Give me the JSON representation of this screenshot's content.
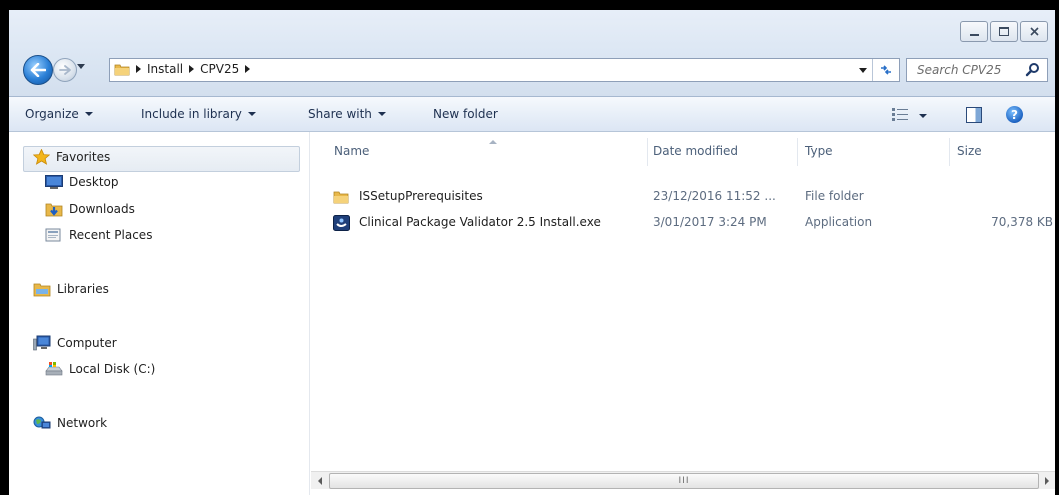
{
  "window": {
    "caption_buttons": [
      "minimize",
      "maximize",
      "close"
    ]
  },
  "address": {
    "crumbs": [
      "Install",
      "CPV25"
    ],
    "refresh_icon": "refresh-icon"
  },
  "search": {
    "placeholder": "Search CPV25"
  },
  "toolbar": {
    "organize": "Organize",
    "include_in_library": "Include in library",
    "share_with": "Share with",
    "new_folder": "New folder"
  },
  "nav": {
    "favorites": "Favorites",
    "desktop": "Desktop",
    "downloads": "Downloads",
    "recent_places": "Recent Places",
    "libraries": "Libraries",
    "computer": "Computer",
    "local_disk": "Local Disk (C:)",
    "network": "Network"
  },
  "columns": {
    "name": "Name",
    "date_modified": "Date modified",
    "type": "Type",
    "size": "Size"
  },
  "files": [
    {
      "name": "ISSetupPrerequisites",
      "date": "23/12/2016 11:52 ...",
      "type": "File folder",
      "size": "",
      "icon": "folder-icon"
    },
    {
      "name": "Clinical Package Validator 2.5 Install.exe",
      "date": "3/01/2017 3:24 PM",
      "type": "Application",
      "size": "70,378 KB",
      "icon": "installer-icon"
    }
  ],
  "scrollbar": {
    "grip": "III"
  },
  "colors": {
    "accent": "#2a7fd6",
    "folder": "#e8b84a"
  }
}
